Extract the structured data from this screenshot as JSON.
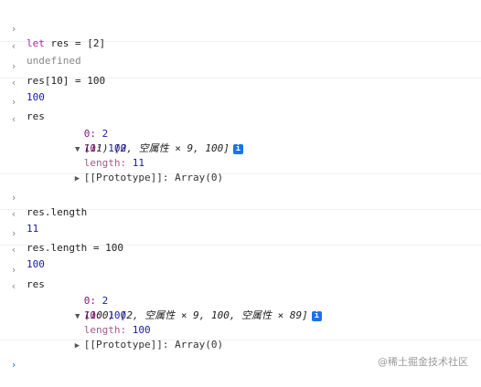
{
  "entries": {
    "e1_in": "let res = [2]",
    "e1_out": "undefined",
    "e2_in": "res[10] = 100",
    "e2_out": "100",
    "e3_in": "res",
    "e3_head": "(11) [2, 空属性 × 9, 100]",
    "e3_k0": "0:",
    "e3_v0": "2",
    "e3_k10": "10:",
    "e3_v10": "100",
    "e3_klen": "length:",
    "e3_vlen": "11",
    "e3_proto": "[[Prototype]]: Array(0)",
    "e4_in": "res.length",
    "e4_out": "11",
    "e5_in": "res.length = 100",
    "e5_out": "100",
    "e6_in": "res",
    "e6_head": "(100) [2, 空属性 × 9, 100, 空属性 × 89]",
    "e6_k0": "0:",
    "e6_v0": "2",
    "e6_k10": "10:",
    "e6_v10": "100",
    "e6_klen": "length:",
    "e6_vlen": "100",
    "e6_proto": "[[Prototype]]: Array(0)"
  },
  "glyphs": {
    "prompt_in": "›",
    "prompt_out": "‹",
    "expanded": "▼",
    "collapsed": "▶",
    "info": "i"
  },
  "watermark": "@稀土掘金技术社区"
}
